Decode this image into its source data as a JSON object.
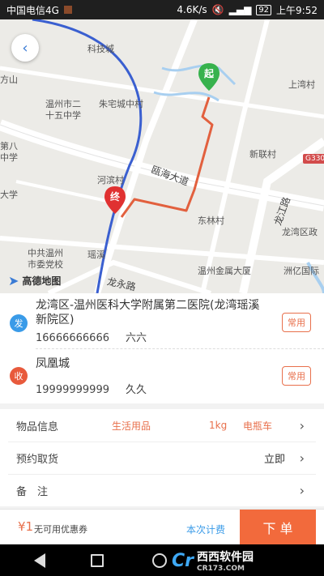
{
  "status_bar": {
    "carrier": "中国电信4G",
    "network_speed": "4.6K/s",
    "battery": "92",
    "time": "上午9:52"
  },
  "map": {
    "provider": "高德地图",
    "labels": {
      "keji_cheng": "科技城",
      "zhuzhai_cheng": "朱宅城中村",
      "wenzhou_25": "温州市二\n十五中学",
      "wenzhou_25_a": "温州市二",
      "wenzhou_25_b": "十五中学",
      "fangshan": "方山",
      "di8": "第八",
      "zhongxue": "中学",
      "daxue": "大学",
      "hebin": "河滨村",
      "ouhai_avenue": "瓯海大道",
      "xinyue_cun": "新联村",
      "shangwan_cun": "上湾村",
      "donglin_cun": "东林村",
      "longjiang_road": "龙江路",
      "longwan_qu": "龙湾区政",
      "wzswdx": "中共温州",
      "wzswdx2": "市委党校",
      "yaoxi": "瑶溪",
      "jinshu": "温州金属大厦",
      "zhouyi": "洲亿国际",
      "longyong_road": "龙永路",
      "g330": "G330",
      "top_road": "龙..."
    },
    "start_pin": "起",
    "end_pin": "终",
    "back_icon": "chevron-left-icon"
  },
  "sender": {
    "badge": "发",
    "address": "龙湾区-温州医科大学附属第二医院(龙湾瑶溪新院区)",
    "phone": "16666666666",
    "name": "六六",
    "common_label": "常用"
  },
  "receiver": {
    "badge": "收",
    "address": "凤凰城",
    "phone": "19999999999",
    "name": "久久",
    "common_label": "常用"
  },
  "goods": {
    "label": "物品信息",
    "category": "生活用品",
    "weight": "1kg",
    "vehicle": "电瓶车"
  },
  "pickup": {
    "label": "预约取货",
    "value": "立即"
  },
  "remark": {
    "label": "备　注"
  },
  "bottom": {
    "price": "¥1",
    "coupon": "无可用优惠券",
    "calc_link": "本次计费",
    "order_button": "下 单"
  },
  "watermark": {
    "brand": "西西软件园",
    "site": "CR173.COM"
  }
}
